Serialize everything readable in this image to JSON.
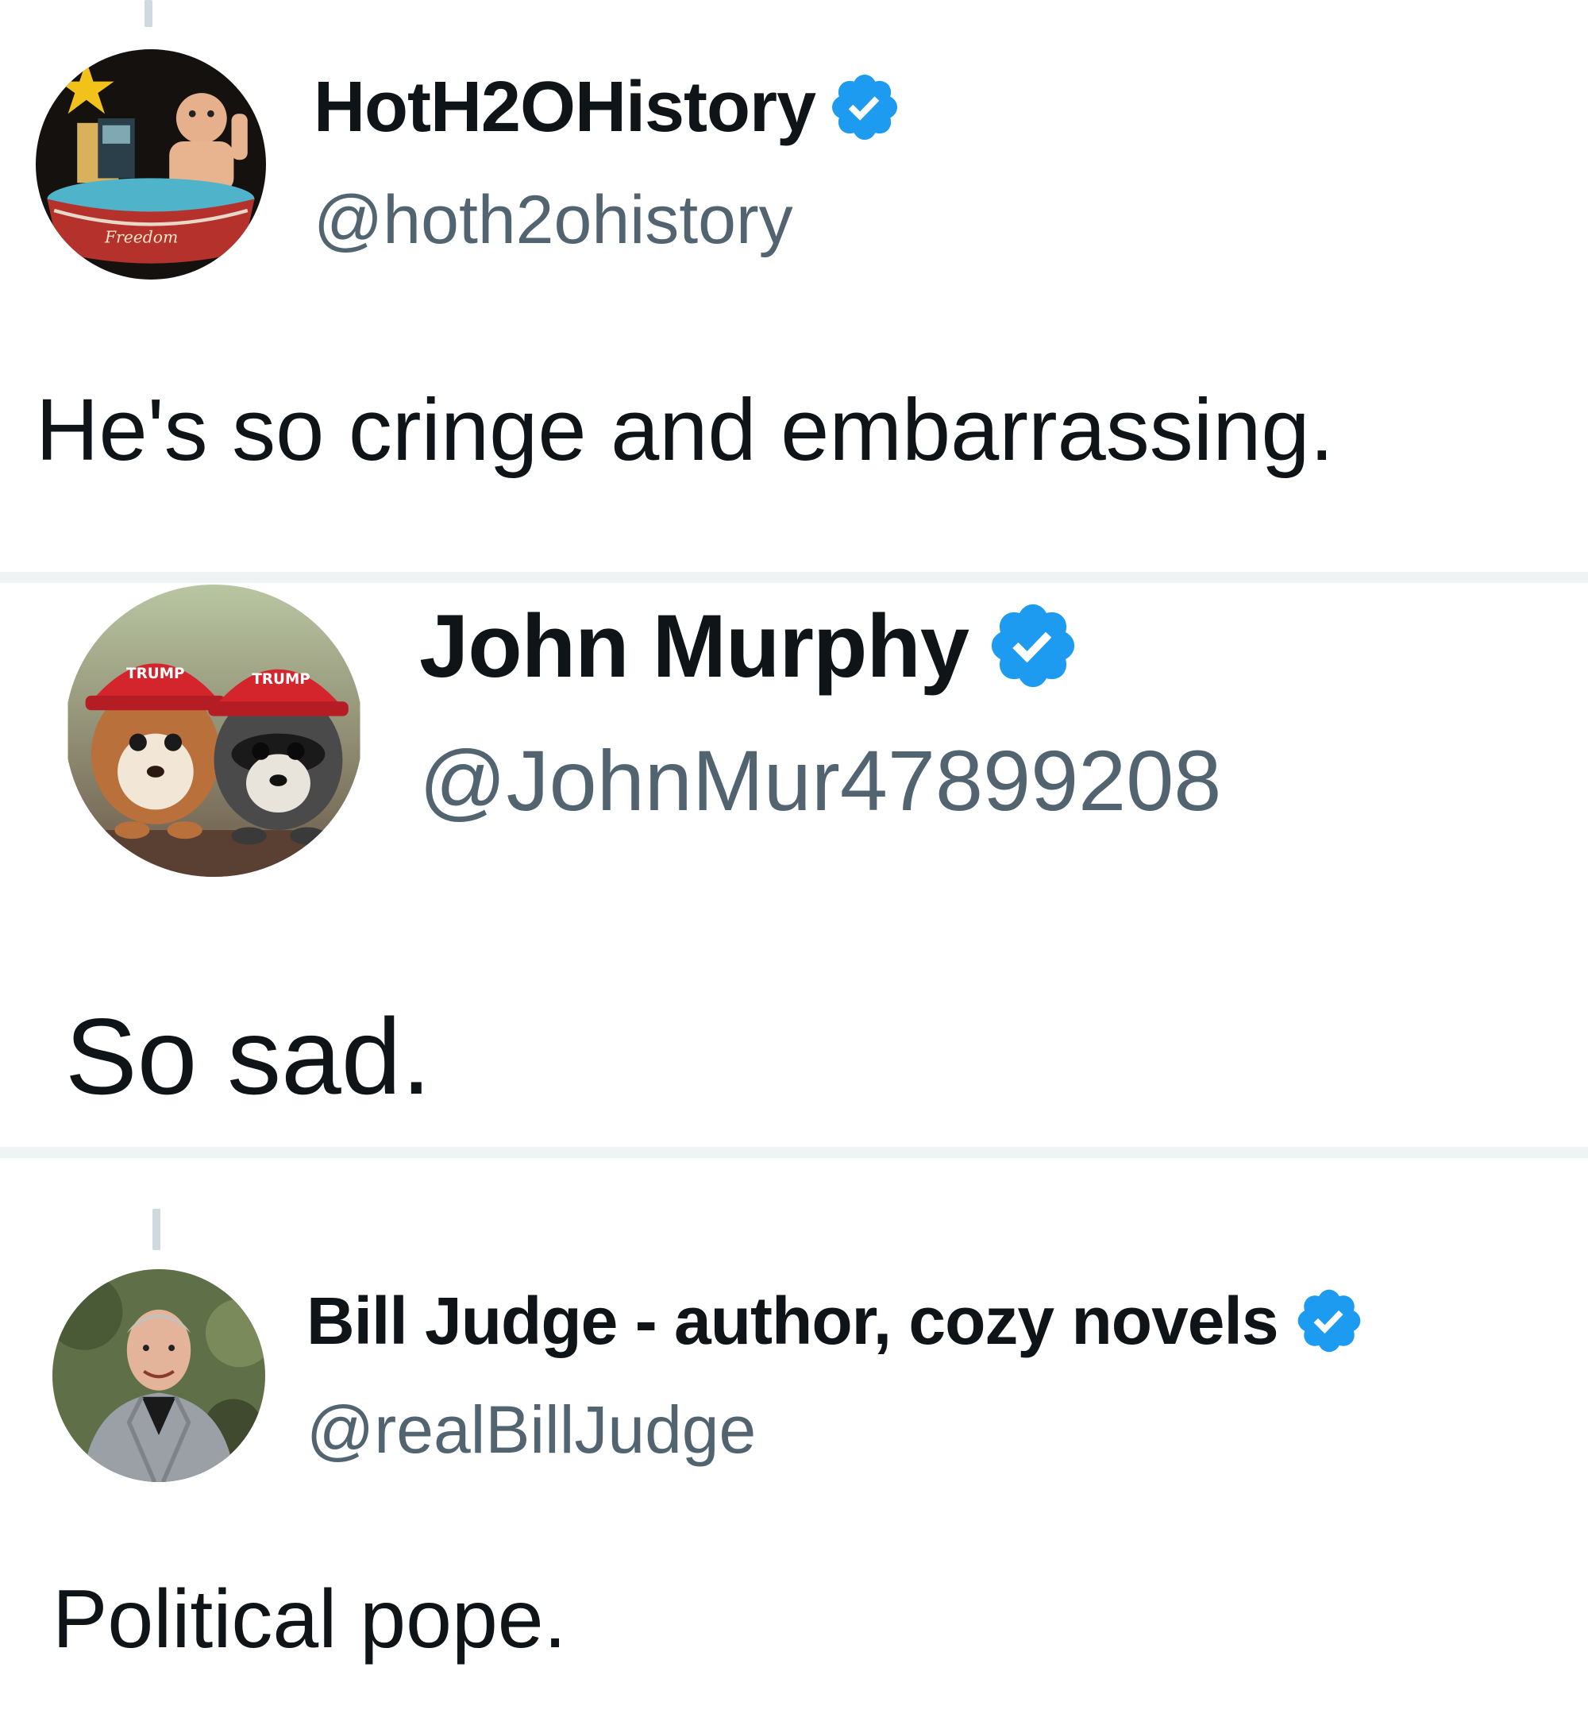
{
  "colors": {
    "verified_badge": "#1d9bf0",
    "handle_text": "#536471",
    "body_text": "#0f1419",
    "divider": "#eff3f4",
    "thread_line": "#cfd9de"
  },
  "posts": [
    {
      "display_name": "HotH2OHistory",
      "handle": "@hoth2ohistory",
      "verified": true,
      "avatar_icon": "hot-tub-avatar-image",
      "text": "He's so cringe and embarrassing."
    },
    {
      "display_name": "John Murphy",
      "handle": "@JohnMur47899208",
      "verified": true,
      "avatar_icon": "animals-in-red-caps-avatar-image",
      "text": "So sad."
    },
    {
      "display_name": "Bill Judge - author, cozy novels",
      "handle": "@realBillJudge",
      "verified": true,
      "avatar_icon": "man-in-gray-suit-avatar-image",
      "text": "Political pope."
    }
  ]
}
